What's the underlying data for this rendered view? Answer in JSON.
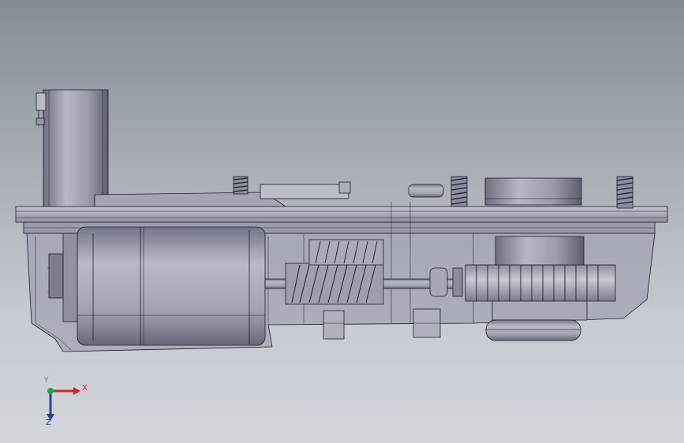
{
  "viewport": {
    "background_top": "#858c96",
    "background_bottom": "#d3d7dc",
    "model_color": "#a8a9b8",
    "edge_color": "#1d1f2a"
  },
  "triad": {
    "x_label": "X",
    "y_label": "Y",
    "z_label": "Z",
    "x_color": "#d2232a",
    "y_color": "#1aa845",
    "z_color": "#2b3fa8"
  }
}
